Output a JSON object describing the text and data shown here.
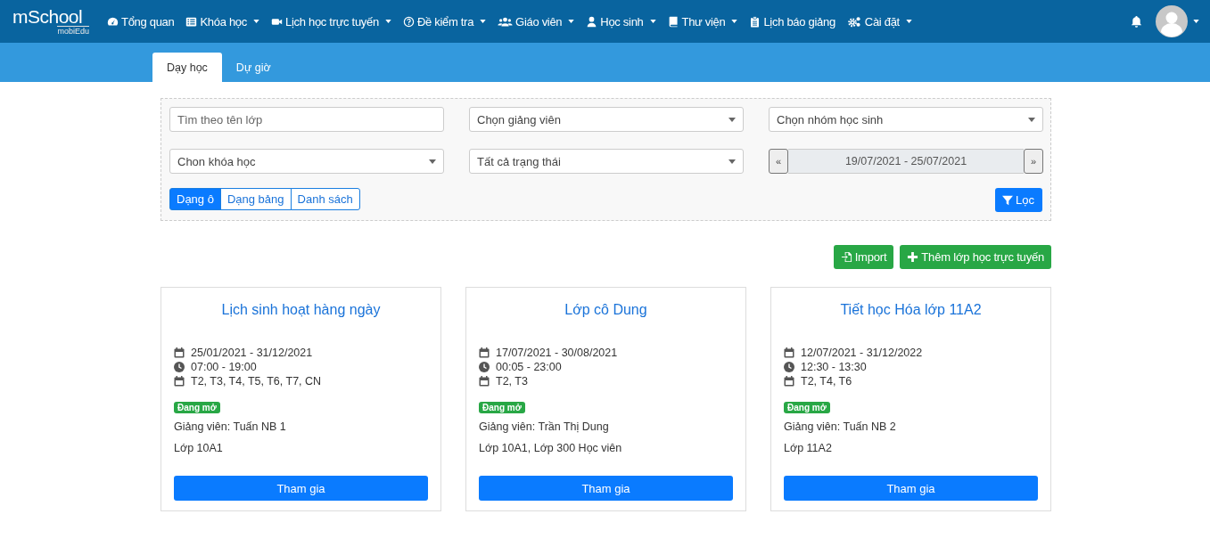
{
  "logo": {
    "name": "mSchool",
    "sub": "mobiEdu"
  },
  "nav": [
    {
      "label": "Tổng quan",
      "dropdown": false
    },
    {
      "label": "Khóa học",
      "dropdown": true
    },
    {
      "label": "Lịch học trực tuyến",
      "dropdown": true
    },
    {
      "label": "Đề kiểm tra",
      "dropdown": true
    },
    {
      "label": "Giáo viên",
      "dropdown": true
    },
    {
      "label": "Học sinh",
      "dropdown": true
    },
    {
      "label": "Thư viện",
      "dropdown": true
    },
    {
      "label": "Lịch báo giảng",
      "dropdown": false
    },
    {
      "label": "Cài đặt",
      "dropdown": true
    }
  ],
  "tabs": [
    {
      "label": "Dạy học",
      "selected": true
    },
    {
      "label": "Dự giờ",
      "selected": false
    }
  ],
  "filters": [
    {
      "kind": "text",
      "placeholder": "Tìm theo tên lớp"
    },
    {
      "kind": "select",
      "value": "Chọn giảng viên"
    },
    {
      "kind": "select",
      "value": "Chọn nhóm học sinh"
    },
    {
      "kind": "select",
      "value": "Chon khóa học"
    },
    {
      "kind": "select",
      "value": "Tất cả trạng thái"
    },
    {
      "kind": "range",
      "prev": "«",
      "value": "19/07/2021 - 25/07/2021",
      "next": "»"
    }
  ],
  "views": [
    {
      "label": "Dạng ô",
      "selected": true
    },
    {
      "label": "Dạng bảng",
      "selected": false
    },
    {
      "label": "Danh sách",
      "selected": false
    }
  ],
  "filter_button": "Lọc",
  "actions": [
    "Import",
    "Thêm lớp học trực tuyến"
  ],
  "classes": [
    {
      "title": "Lịch sinh hoạt hàng ngày",
      "lines": [
        {
          "kind": "calendar",
          "text": "25/01/2021 - 31/12/2021"
        },
        {
          "kind": "clock",
          "text": "07:00 - 19:00"
        },
        {
          "kind": "calendar",
          "text": "T2, T3, T4, T5, T6, T7, CN"
        }
      ],
      "status": "Đang mở",
      "teacher": "Giảng viên: Tuấn NB 1",
      "groups": "Lớp 10A1",
      "button": "Tham gia"
    },
    {
      "title": "Lớp cô Dung",
      "lines": [
        {
          "kind": "calendar",
          "text": "17/07/2021 - 30/08/2021"
        },
        {
          "kind": "clock",
          "text": "00:05 - 23:00"
        },
        {
          "kind": "calendar",
          "text": "T2, T3"
        }
      ],
      "status": "Đang mở",
      "teacher": "Giảng viên: Trần Thị Dung",
      "groups": "Lớp 10A1, Lớp 300 Học viên",
      "button": "Tham gia"
    },
    {
      "title": "Tiết học Hóa lớp 11A2",
      "lines": [
        {
          "kind": "calendar",
          "text": "12/07/2021 - 31/12/2022"
        },
        {
          "kind": "clock",
          "text": "12:30 - 13:30"
        },
        {
          "kind": "calendar",
          "text": "T2, T4, T6"
        }
      ],
      "status": "Đang mở",
      "teacher": "Giảng viên: Tuấn NB 2",
      "groups": "Lớp 11A2",
      "button": "Tham gia"
    }
  ]
}
